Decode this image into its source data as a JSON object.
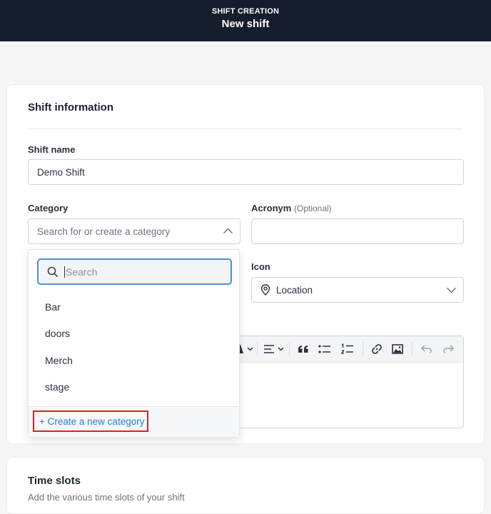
{
  "header": {
    "eyebrow": "SHIFT CREATION",
    "title": "New shift"
  },
  "shift_info": {
    "title": "Shift information",
    "shift_name_label": "Shift name",
    "shift_name_value": "Demo Shift",
    "category_label": "Category",
    "category_placeholder": "Search for or create a category",
    "acronym_label": "Acronym",
    "acronym_optional": "(Optional)",
    "acronym_value": "",
    "icon_label": "Icon",
    "icon_value": "Location"
  },
  "dropdown": {
    "search_placeholder": "Search",
    "items": [
      "Bar",
      "doors",
      "Merch",
      "stage"
    ],
    "create_label": "+ Create a new category"
  },
  "time_slots": {
    "title": "Time slots",
    "subtitle": "Add the various time slots of your shift"
  },
  "colors": {
    "header_bg": "#161d2d",
    "accent": "#2f7fd3",
    "highlight": "#e02020"
  }
}
